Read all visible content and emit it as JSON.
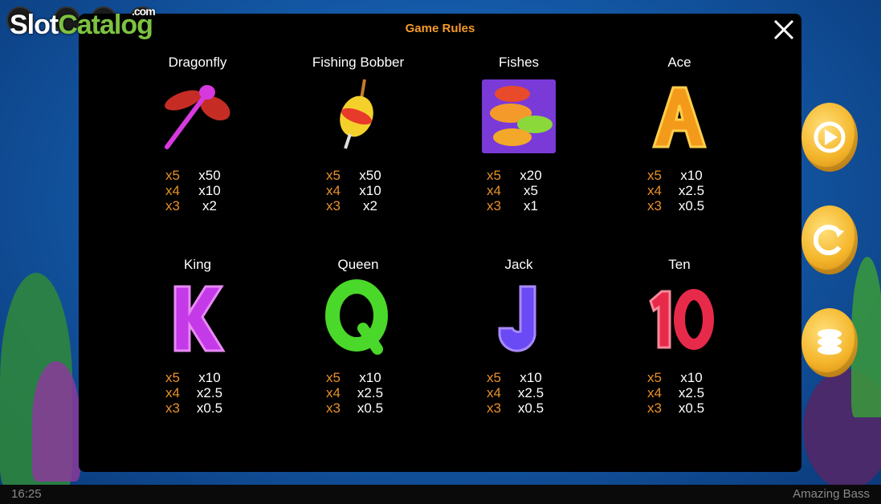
{
  "watermark": {
    "part1": "Slot",
    "part2": "Catalog",
    "part3": ".com"
  },
  "modal": {
    "title": "Game Rules"
  },
  "symbols": [
    {
      "name": "Dragonfly",
      "icon": "dragonfly-icon",
      "pays": [
        [
          "x5",
          "x50"
        ],
        [
          "x4",
          "x10"
        ],
        [
          "x3",
          "x2"
        ]
      ]
    },
    {
      "name": "Fishing Bobber",
      "icon": "fishing-bobber-icon",
      "pays": [
        [
          "x5",
          "x50"
        ],
        [
          "x4",
          "x10"
        ],
        [
          "x3",
          "x2"
        ]
      ]
    },
    {
      "name": "Fishes",
      "icon": "fishes-icon",
      "pays": [
        [
          "x5",
          "x20"
        ],
        [
          "x4",
          "x5"
        ],
        [
          "x3",
          "x1"
        ]
      ]
    },
    {
      "name": "Ace",
      "icon": "ace-icon",
      "pays": [
        [
          "x5",
          "x10"
        ],
        [
          "x4",
          "x2.5"
        ],
        [
          "x3",
          "x0.5"
        ]
      ]
    },
    {
      "name": "King",
      "icon": "king-icon",
      "pays": [
        [
          "x5",
          "x10"
        ],
        [
          "x4",
          "x2.5"
        ],
        [
          "x3",
          "x0.5"
        ]
      ]
    },
    {
      "name": "Queen",
      "icon": "queen-icon",
      "pays": [
        [
          "x5",
          "x10"
        ],
        [
          "x4",
          "x2.5"
        ],
        [
          "x3",
          "x0.5"
        ]
      ]
    },
    {
      "name": "Jack",
      "icon": "jack-icon",
      "pays": [
        [
          "x5",
          "x10"
        ],
        [
          "x4",
          "x2.5"
        ],
        [
          "x3",
          "x0.5"
        ]
      ]
    },
    {
      "name": "Ten",
      "icon": "ten-icon",
      "pays": [
        [
          "x5",
          "x10"
        ],
        [
          "x4",
          "x2.5"
        ],
        [
          "x3",
          "x0.5"
        ]
      ]
    }
  ],
  "status": {
    "time": "16:25",
    "game": "Amazing Bass"
  },
  "colors": {
    "title": "#f59a2a",
    "count": "#e8902a",
    "modal_bg": "#000000",
    "coin": "#f4b52a"
  }
}
